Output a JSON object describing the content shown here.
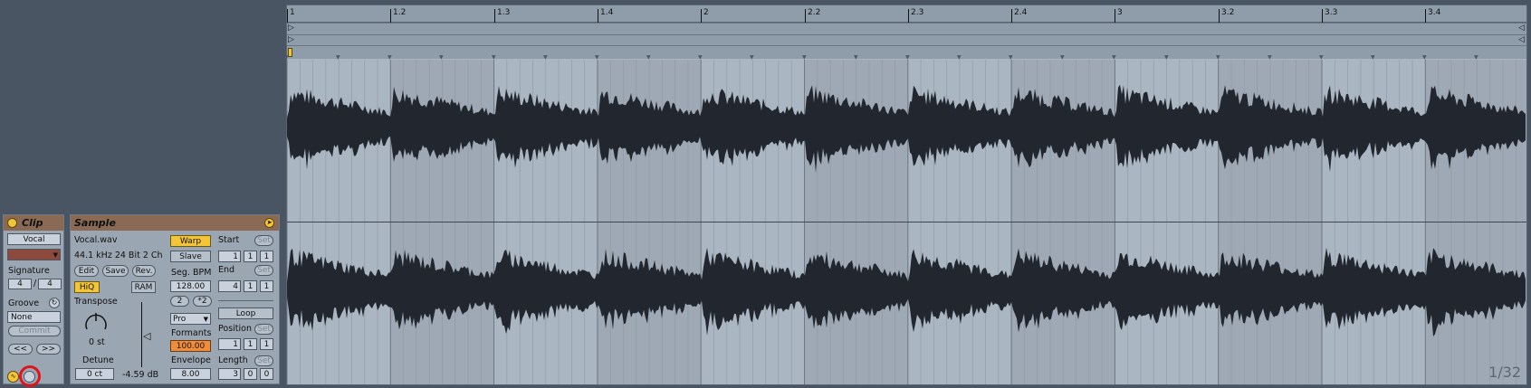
{
  "clip": {
    "title": "Clip",
    "name": "Vocal",
    "signature_label": "Signature",
    "sig_num": "4",
    "sig_sep": "/",
    "sig_den": "4",
    "groove_label": "Groove",
    "groove_value": "None",
    "commit_label": "Commit",
    "prev_label": "<<",
    "next_label": ">>",
    "color_swatch": "#8b4a3c"
  },
  "sample": {
    "title": "Sample",
    "filename": "Vocal.wav",
    "format": "44.1 kHz 24 Bit 2 Ch",
    "edit_label": "Edit",
    "save_label": "Save",
    "rev_label": "Rev.",
    "hiq_label": "HiQ",
    "ram_label": "RAM",
    "transpose_label": "Transpose",
    "transpose_value": "0 st",
    "detune_label": "Detune",
    "detune_value": "0 ct",
    "gain_value": "-4.59 dB",
    "warp_label": "Warp",
    "slave_label": "Slave",
    "seg_bpm_label": "Seg. BPM",
    "seg_bpm_value": "128.00",
    "half_label": "2",
    "double_label": "*2",
    "warp_mode": "Pro",
    "formants_label": "Formants",
    "formants_value": "100.00",
    "envelope_label": "Envelope",
    "envelope_value": "8.00",
    "start_label": "Start",
    "start_values": [
      "1",
      "1",
      "1"
    ],
    "end_label": "End",
    "end_values": [
      "4",
      "1",
      "1"
    ],
    "set_label": "Set",
    "loop_label": "Loop",
    "position_label": "Position",
    "position_values": [
      "1",
      "1",
      "1"
    ],
    "length_label": "Length",
    "length_values": [
      "3",
      "0",
      "0"
    ]
  },
  "ruler": {
    "labels": [
      "1",
      "1.2",
      "1.3",
      "1.4",
      "2",
      "2.2",
      "2.3",
      "2.4",
      "3",
      "3.2",
      "3.3",
      "3.4"
    ]
  },
  "zoom": "1/32",
  "colors": {
    "accent_yellow": "#f4c537",
    "accent_orange": "#f18c3a",
    "waveform": "#22272f",
    "highlight_circle": "#e0141e"
  }
}
